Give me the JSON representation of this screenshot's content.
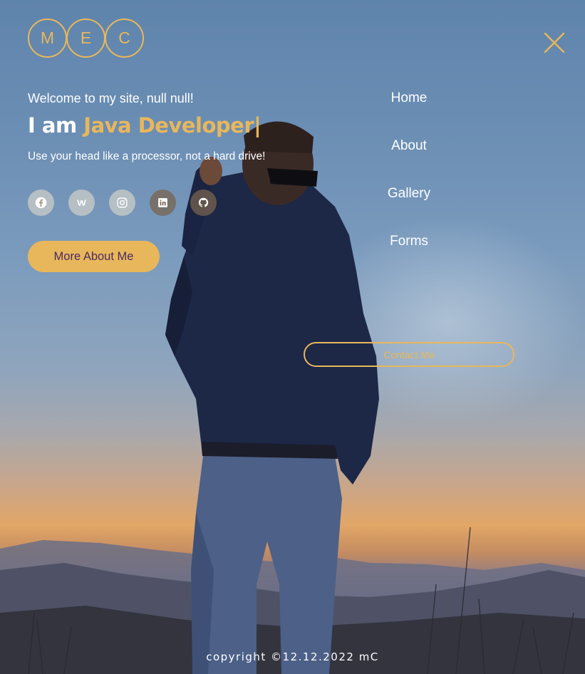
{
  "logo": {
    "letters": [
      "M",
      "E",
      "C"
    ]
  },
  "hero": {
    "welcome": "Welcome to my site, null null!",
    "iam": "I am",
    "role": "Java Developer",
    "cursor": "|",
    "motto": "Use your head like a processor, not a hard drive!"
  },
  "socials": [
    {
      "name": "facebook-icon"
    },
    {
      "name": "wattpad-icon"
    },
    {
      "name": "instagram-icon"
    },
    {
      "name": "linkedin-icon"
    },
    {
      "name": "github-icon"
    }
  ],
  "buttons": {
    "more_about": "More About Me",
    "contact": "Contact Me"
  },
  "nav": {
    "items": [
      {
        "label": "Home"
      },
      {
        "label": "About"
      },
      {
        "label": "Gallery"
      },
      {
        "label": "Forms"
      }
    ]
  },
  "footer": {
    "copyright": "copyright ©12.12.2022 mC"
  },
  "colors": {
    "accent": "#e8b75b",
    "button_text": "#4b2a62",
    "text": "#ffffff"
  }
}
